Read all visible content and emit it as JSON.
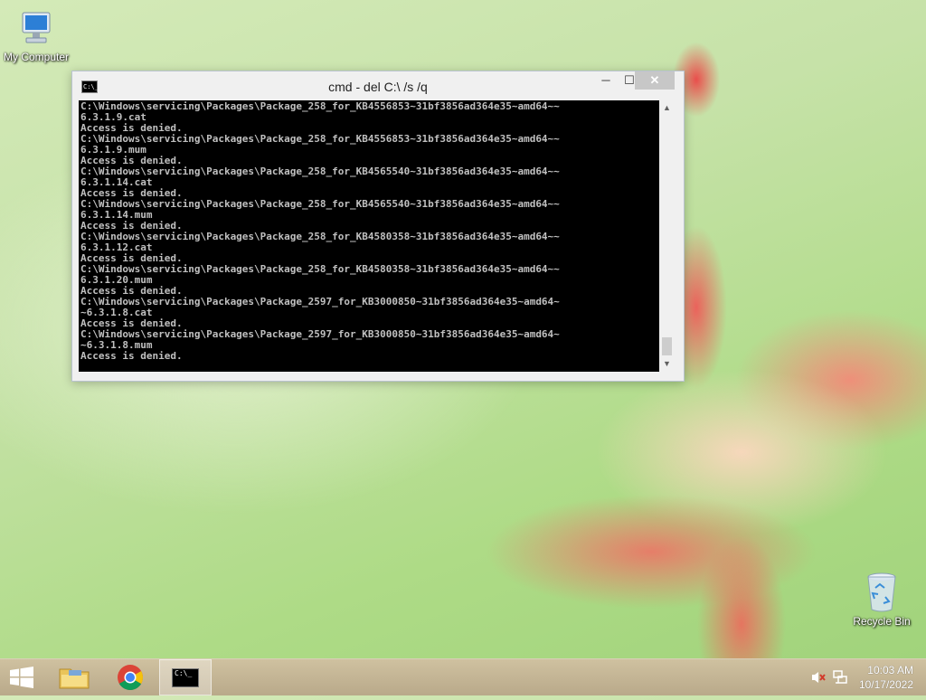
{
  "desktop": {
    "icons": [
      {
        "label": "My Computer"
      },
      {
        "label": "Recycle Bin"
      }
    ]
  },
  "cmd_window": {
    "title": "cmd - del  C:\\ /s /q",
    "icon_text": "C:\\_",
    "min_symbol": "─",
    "max_symbol": "☐",
    "close_symbol": "✕",
    "scroll_up_symbol": "▲",
    "scroll_down_symbol": "▼",
    "console_lines": [
      "C:\\Windows\\servicing\\Packages\\Package_258_for_KB4556853~31bf3856ad364e35~amd64~~",
      "6.3.1.9.cat",
      "Access is denied.",
      "C:\\Windows\\servicing\\Packages\\Package_258_for_KB4556853~31bf3856ad364e35~amd64~~",
      "6.3.1.9.mum",
      "Access is denied.",
      "C:\\Windows\\servicing\\Packages\\Package_258_for_KB4565540~31bf3856ad364e35~amd64~~",
      "6.3.1.14.cat",
      "Access is denied.",
      "C:\\Windows\\servicing\\Packages\\Package_258_for_KB4565540~31bf3856ad364e35~amd64~~",
      "6.3.1.14.mum",
      "Access is denied.",
      "C:\\Windows\\servicing\\Packages\\Package_258_for_KB4580358~31bf3856ad364e35~amd64~~",
      "6.3.1.12.cat",
      "Access is denied.",
      "C:\\Windows\\servicing\\Packages\\Package_258_for_KB4580358~31bf3856ad364e35~amd64~~",
      "6.3.1.20.mum",
      "Access is denied.",
      "C:\\Windows\\servicing\\Packages\\Package_2597_for_KB3000850~31bf3856ad364e35~amd64~",
      "~6.3.1.8.cat",
      "Access is denied.",
      "C:\\Windows\\servicing\\Packages\\Package_2597_for_KB3000850~31bf3856ad364e35~amd64~",
      "~6.3.1.8.mum",
      "Access is denied."
    ]
  },
  "taskbar": {
    "cmd_task_icon_text": "C:\\_",
    "clock_time": "10:03 AM",
    "clock_date": "10/17/2022"
  }
}
